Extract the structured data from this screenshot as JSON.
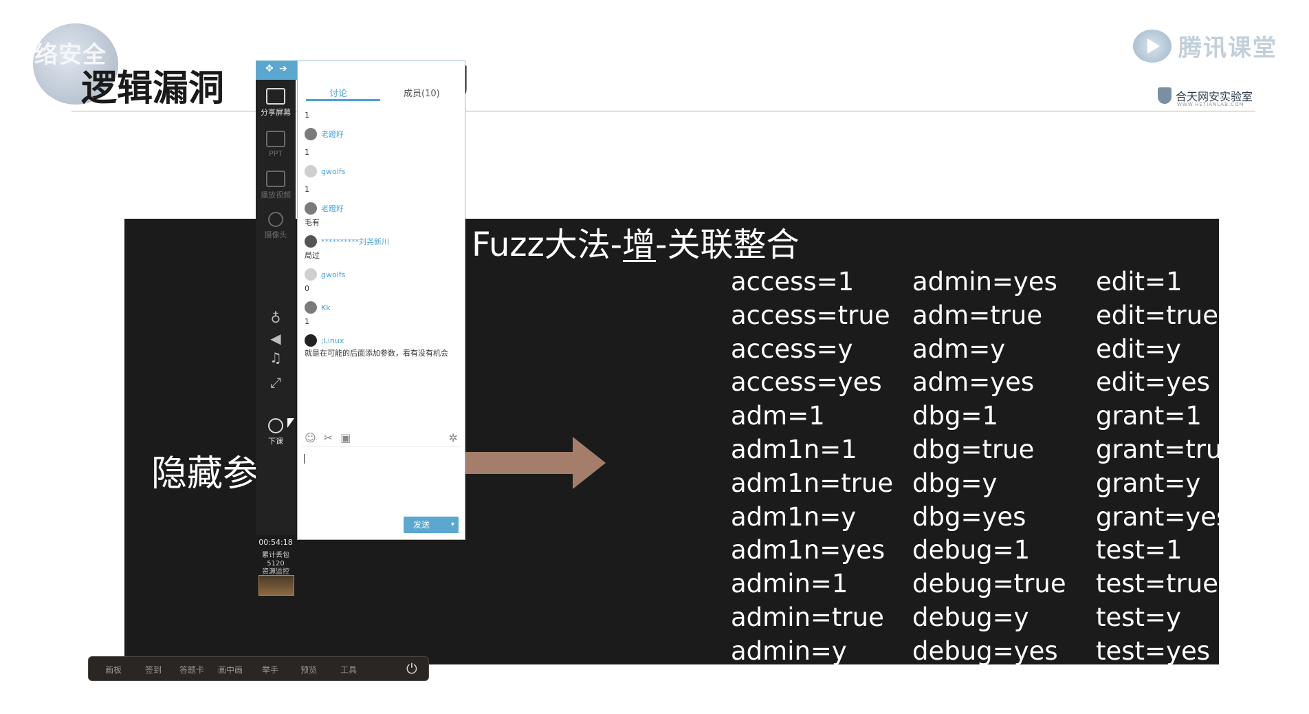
{
  "header": {
    "tag": "络安全",
    "title": "逻辑漏洞",
    "title_tail": "J",
    "brand": "腾讯课堂",
    "lab": "合天网安实验室",
    "lab_sub": "WWW.HETIANLAB.COM"
  },
  "slide": {
    "title": "Fuzz大法-增-关联整合",
    "left_label": "隐藏参",
    "columns": [
      [
        "access=1",
        "access=true",
        "access=y",
        "access=yes",
        "adm=1",
        "adm1n=1",
        "adm1n=true",
        "adm1n=y",
        "adm1n=yes",
        "admin=1",
        "admin=true",
        "admin=y"
      ],
      [
        "admin=yes",
        "adm=true",
        "adm=y",
        "adm=yes",
        "dbg=1",
        "dbg=true",
        "dbg=y",
        "dbg=yes",
        "debug=1",
        "debug=true",
        "debug=y",
        "debug=yes"
      ],
      [
        "edit=1",
        "edit=true",
        "edit=y",
        "edit=yes",
        "grant=1",
        "grant=true",
        "grant=y",
        "grant=yes",
        "test=1",
        "test=true",
        "test=y",
        "test=yes"
      ]
    ],
    "arrow_color": "#a57e6b"
  },
  "sidebar": {
    "share_label": "分享屏幕",
    "ppt_label": "PPT",
    "video_label": "播放视频",
    "camera_label": "摄像头",
    "end_label": "下课",
    "timer": "00:54:18",
    "stats_1": "累计丢包",
    "stats_2": "5120",
    "stats_3": "资源监控"
  },
  "chat": {
    "tab_discuss": "讨论",
    "tab_members": "成员(10)",
    "messages": [
      {
        "text": "1"
      },
      {
        "user": "老蹬籽"
      },
      {
        "text": "1"
      },
      {
        "user": "gwolfs"
      },
      {
        "text": "1"
      },
      {
        "user": "老蹬籽"
      },
      {
        "text": "毛有"
      },
      {
        "user": "**********刘尧新川"
      },
      {
        "text": "局过"
      },
      {
        "user": "gwolfs"
      },
      {
        "text": "0"
      },
      {
        "user": "Kk"
      },
      {
        "text": "1"
      },
      {
        "user": ";Linux"
      },
      {
        "text": "就是在可能的后面添加参数，看有没有机会"
      }
    ],
    "send_label": "发送"
  },
  "bottombar": {
    "items": [
      "画板",
      "签到",
      "答题卡",
      "画中画",
      "举手",
      "预览",
      "工具"
    ]
  }
}
